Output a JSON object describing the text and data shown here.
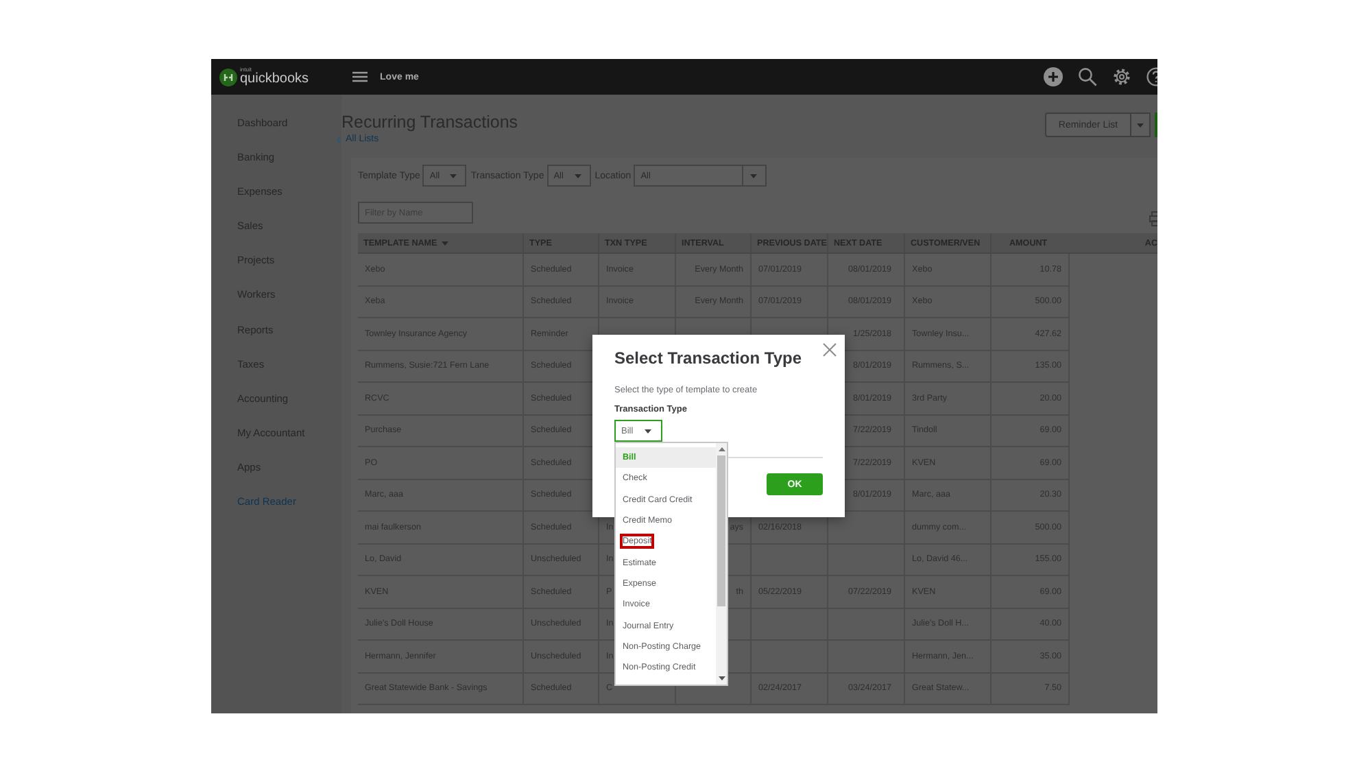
{
  "app": {
    "brand_small": "intuit",
    "brand": "quickbooks",
    "company": "Love me"
  },
  "sidebar": {
    "items": [
      {
        "label": "Dashboard",
        "kind": "item"
      },
      {
        "label": "Banking",
        "kind": "item"
      },
      {
        "label": "Expenses",
        "kind": "item"
      },
      {
        "label": "Sales",
        "kind": "item"
      },
      {
        "label": "Projects",
        "kind": "item"
      },
      {
        "label": "Workers",
        "kind": "item"
      },
      {
        "label": "Reports",
        "kind": "item"
      },
      {
        "label": "Taxes",
        "kind": "item"
      },
      {
        "label": "Accounting",
        "kind": "item"
      },
      {
        "label": "My Accountant",
        "kind": "item"
      },
      {
        "label": "Apps",
        "kind": "item"
      },
      {
        "label": "Card Reader",
        "kind": "link"
      }
    ]
  },
  "page": {
    "title": "Recurring Transactions",
    "back_link": "All Lists",
    "button": "Reminder List"
  },
  "filters": [
    {
      "label": "Template Type",
      "value": "All"
    },
    {
      "label": "Transaction Type",
      "value": "All"
    },
    {
      "label": "Location",
      "value": "All"
    }
  ],
  "name_filter": {
    "placeholder": "Filter by Name"
  },
  "table": {
    "columns": [
      {
        "label": "TEMPLATE NAME",
        "sorted": true
      },
      {
        "label": "TYPE",
        "sorted": false
      },
      {
        "label": "TXN TYPE",
        "sorted": false
      },
      {
        "label": "INTERVAL",
        "sorted": false
      },
      {
        "label": "PREVIOUS DATE",
        "sorted": false
      },
      {
        "label": "NEXT DATE",
        "sorted": false
      },
      {
        "label": "CUSTOMER/VEN",
        "sorted": false
      },
      {
        "label": "AMOUNT",
        "sorted": false
      },
      {
        "label": "AC",
        "sorted": false
      }
    ],
    "rows": [
      {
        "name": "Xebo",
        "type": "Scheduled",
        "txn_type": "Invoice",
        "interval": "Every Month",
        "previous_date": "07/01/2019",
        "next_date": "08/01/2019",
        "customer": "Xebo",
        "amount": "10.78"
      },
      {
        "name": "Xeba",
        "type": "Scheduled",
        "txn_type": "Invoice",
        "interval": "Every Month",
        "previous_date": "07/01/2019",
        "next_date": "08/01/2019",
        "customer": "Xebo",
        "amount": "500.00"
      },
      {
        "name": "Townley Insurance Agency",
        "type": "Reminder",
        "next_date": "1/25/2018",
        "customer": "Townley Insu...",
        "amount": "427.62"
      },
      {
        "name": "Rummens, Susie:721 Fern Lane",
        "type": "Scheduled",
        "next_date": "8/01/2019",
        "customer": "Rummens, S...",
        "amount": "135.00"
      },
      {
        "name": "RCVC",
        "type": "Scheduled",
        "next_date": "8/01/2019",
        "customer": "3rd Party",
        "amount": "20.00"
      },
      {
        "name": "Purchase",
        "type": "Scheduled",
        "next_date": "7/22/2019",
        "customer": "Tindoll",
        "amount": "69.00"
      },
      {
        "name": "PO",
        "type": "Scheduled",
        "next_date": "7/22/2019",
        "customer": "KVEN",
        "amount": "69.00"
      },
      {
        "name": "Marc, aaa",
        "type": "Scheduled",
        "next_date": "8/01/2019",
        "customer": "Marc, aaa",
        "amount": "20.30"
      },
      {
        "name": "mai faulkerson",
        "type": "Scheduled",
        "txn_type": "In",
        "interval": "ays",
        "previous_date": "02/16/2018",
        "customer": "dummy com...",
        "amount": "500.00"
      },
      {
        "name": "Lo, David",
        "type": "Unscheduled",
        "txn_type": "In",
        "customer": "Lo, David 46...",
        "amount": "155.00"
      },
      {
        "name": "KVEN",
        "type": "Scheduled",
        "txn_type": "P",
        "interval": "th",
        "previous_date": "05/22/2019",
        "next_date": "07/22/2019",
        "customer": "KVEN",
        "amount": "69.00"
      },
      {
        "name": "Julie's Doll House",
        "type": "Unscheduled",
        "txn_type": "In",
        "customer": "Julie's Doll H...",
        "amount": "40.00"
      },
      {
        "name": "Hermann, Jennifer",
        "type": "Unscheduled",
        "txn_type": "In",
        "customer": "Hermann, Jen...",
        "amount": "35.00"
      },
      {
        "name": "Great Statewide Bank - Savings",
        "type": "Scheduled",
        "txn_type": "C",
        "previous_date": "02/24/2017",
        "next_date": "03/24/2017",
        "customer": "Great Statew...",
        "amount": "7.50"
      }
    ]
  },
  "dialog": {
    "title": "Select Transaction Type",
    "subtitle": "Select the type of template to create",
    "field_label": "Transaction Type",
    "field_value": "Bill",
    "ok_button": "OK",
    "options": [
      {
        "label": "Bill",
        "selected": true,
        "highlighted": false
      },
      {
        "label": "Check",
        "selected": false,
        "highlighted": false
      },
      {
        "label": "Credit Card Credit",
        "selected": false,
        "highlighted": false
      },
      {
        "label": "Credit Memo",
        "selected": false,
        "highlighted": false
      },
      {
        "label": "Deposit",
        "selected": false,
        "highlighted": true
      },
      {
        "label": "Estimate",
        "selected": false,
        "highlighted": false
      },
      {
        "label": "Expense",
        "selected": false,
        "highlighted": false
      },
      {
        "label": "Invoice",
        "selected": false,
        "highlighted": false
      },
      {
        "label": "Journal Entry",
        "selected": false,
        "highlighted": false
      },
      {
        "label": "Non-Posting Charge",
        "selected": false,
        "highlighted": false
      },
      {
        "label": "Non-Posting Credit",
        "selected": false,
        "highlighted": false
      }
    ]
  }
}
